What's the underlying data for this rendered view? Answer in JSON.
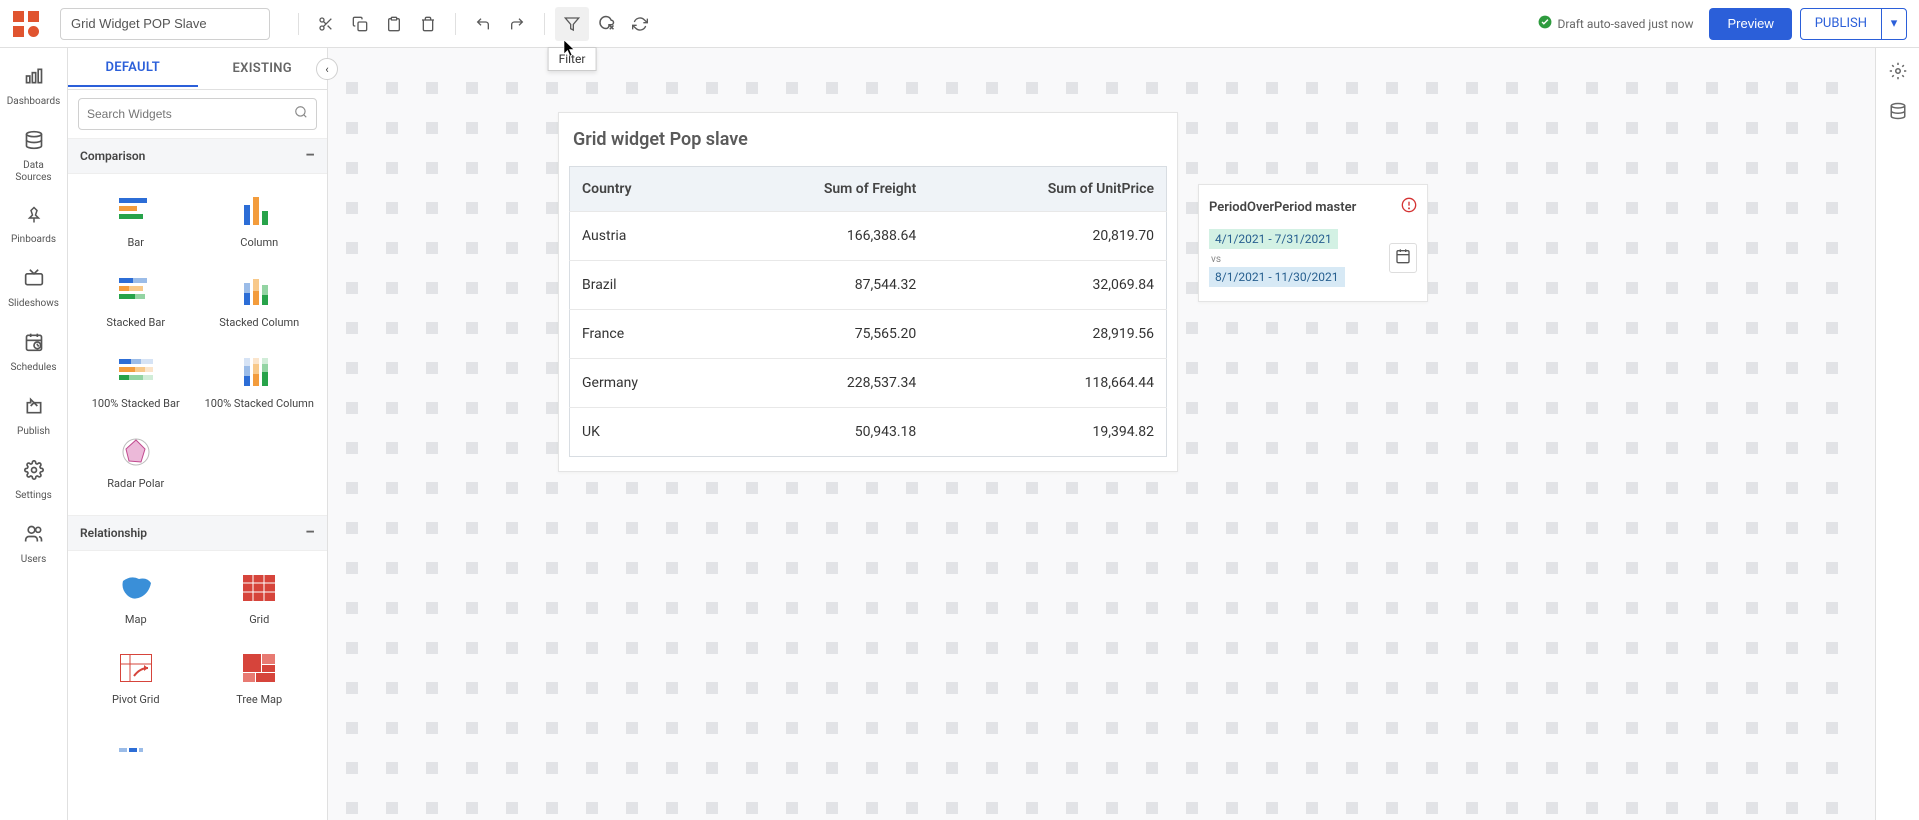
{
  "top": {
    "title_value": "Grid Widget POP Slave",
    "toolbar": {
      "cut": "cut-icon",
      "copy": "copy-icon",
      "paste": "paste-icon",
      "delete": "delete-icon",
      "undo": "undo-icon",
      "redo": "redo-icon",
      "filter": "filter-icon",
      "filter_tooltip": "Filter",
      "image": "image-icon",
      "refresh": "refresh-icon"
    },
    "save_status": "Draft auto-saved just now",
    "preview": "Preview",
    "publish": "PUBLISH"
  },
  "left_rail": [
    {
      "label": "Dashboards"
    },
    {
      "label": "Data Sources"
    },
    {
      "label": "Pinboards"
    },
    {
      "label": "Slideshows"
    },
    {
      "label": "Schedules"
    },
    {
      "label": "Publish"
    },
    {
      "label": "Settings"
    },
    {
      "label": "Users"
    }
  ],
  "widget_panel": {
    "tab_default": "DEFAULT",
    "tab_existing": "EXISTING",
    "search_placeholder": "Search Widgets",
    "categories": {
      "comparison": {
        "title": "Comparison",
        "items": [
          {
            "label": "Bar"
          },
          {
            "label": "Column"
          },
          {
            "label": "Stacked Bar"
          },
          {
            "label": "Stacked Column"
          },
          {
            "label": "100% Stacked Bar"
          },
          {
            "label": "100% Stacked Column"
          },
          {
            "label": "Radar Polar"
          }
        ]
      },
      "relationship": {
        "title": "Relationship",
        "items": [
          {
            "label": "Map"
          },
          {
            "label": "Grid"
          },
          {
            "label": "Pivot Grid"
          },
          {
            "label": "Tree Map"
          }
        ]
      }
    }
  },
  "grid_widget": {
    "title": "Grid widget Pop slave",
    "columns": [
      "Country",
      "Sum of Freight",
      "Sum of UnitPrice"
    ],
    "rows": [
      {
        "c": "Austria",
        "f": "166,388.64",
        "u": "20,819.70"
      },
      {
        "c": "Brazil",
        "f": "87,544.32",
        "u": "32,069.84"
      },
      {
        "c": "France",
        "f": "75,565.20",
        "u": "28,919.56"
      },
      {
        "c": "Germany",
        "f": "228,537.34",
        "u": "118,664.44"
      },
      {
        "c": "UK",
        "f": "50,943.18",
        "u": "19,394.82"
      }
    ]
  },
  "period_widget": {
    "title": "PeriodOverPeriod master",
    "range1": "4/1/2021 - 7/31/2021",
    "vs": "vs",
    "range2": "8/1/2021 - 11/30/2021"
  }
}
